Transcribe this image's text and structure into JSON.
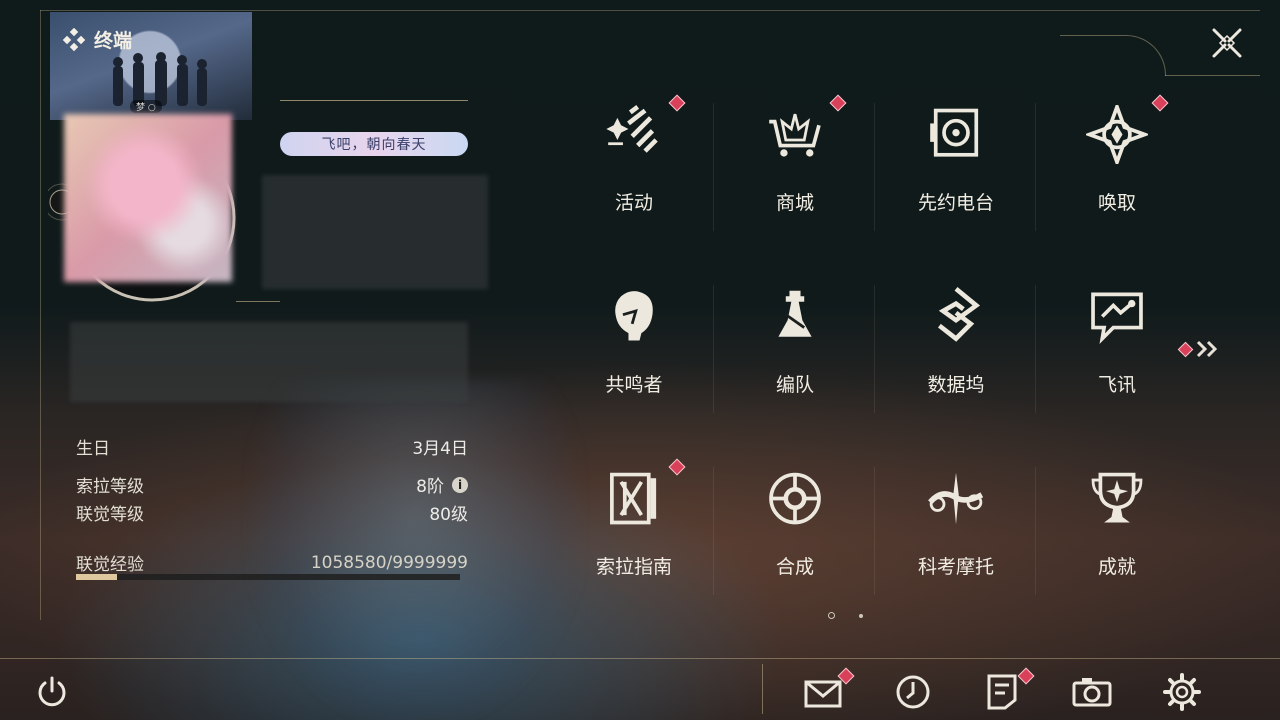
{
  "terminal": {
    "title": "终端"
  },
  "profile": {
    "banner_caption": "梦 ○",
    "signature": "飞吧，朝向春天",
    "birthday_label": "生日",
    "birthday_value": "3月4日",
    "sola_level_label": "索拉等级",
    "sola_level_value": "8阶",
    "union_level_label": "联觉等级",
    "union_level_value": "80级",
    "union_exp_label": "联觉经验",
    "union_exp_value": "1058580/9999999",
    "union_exp_fraction": 0.1059
  },
  "menu": {
    "page": 1,
    "page_count": 2,
    "items": [
      {
        "label": "活动",
        "icon": "event-sparkle-icon",
        "badge": true
      },
      {
        "label": "商城",
        "icon": "shop-cart-icon",
        "badge": true
      },
      {
        "label": "先约电台",
        "icon": "radio-speaker-icon",
        "badge": false
      },
      {
        "label": "唤取",
        "icon": "convene-compass-icon",
        "badge": true
      },
      {
        "label": "共鸣者",
        "icon": "resonator-portrait-icon",
        "badge": false
      },
      {
        "label": "编队",
        "icon": "team-chess-icon",
        "badge": false
      },
      {
        "label": "数据坞",
        "icon": "data-bank-icon",
        "badge": false
      },
      {
        "label": "飞讯",
        "icon": "message-chat-icon",
        "badge": false
      },
      {
        "label": "索拉指南",
        "icon": "guidebook-icon",
        "badge": true
      },
      {
        "label": "合成",
        "icon": "synthesis-icon",
        "badge": false
      },
      {
        "label": "科考摩托",
        "icon": "motorbike-icon",
        "badge": false
      },
      {
        "label": "成就",
        "icon": "achievement-trophy-icon",
        "badge": false
      }
    ]
  },
  "bottom_bar": {
    "icons": [
      "mail-icon",
      "clock-icon",
      "notes-icon",
      "camera-icon",
      "settings-gear-icon"
    ],
    "mail_badge": true,
    "notes_badge": true
  },
  "colors": {
    "accent_gold": "#c9b88f",
    "badge_red": "#d9405a",
    "text_light": "#f1ede3"
  }
}
